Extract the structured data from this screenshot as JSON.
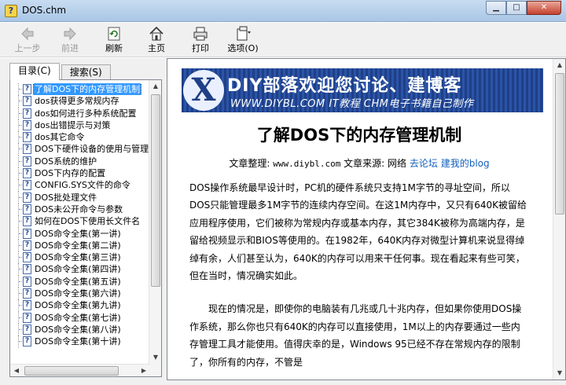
{
  "window": {
    "title": "DOS.chm"
  },
  "toolbar": {
    "buttons": [
      {
        "label": "上一步",
        "icon": "back-arrow-icon",
        "enabled": false
      },
      {
        "label": "前进",
        "icon": "forward-arrow-icon",
        "enabled": false
      },
      {
        "label": "刷新",
        "icon": "refresh-icon",
        "enabled": true
      },
      {
        "label": "主页",
        "icon": "home-icon",
        "enabled": true
      },
      {
        "label": "打印",
        "icon": "printer-icon",
        "enabled": true
      },
      {
        "label": "选项(O)",
        "icon": "options-icon",
        "enabled": true
      }
    ]
  },
  "nav": {
    "tabs": [
      {
        "label": "目录(C)",
        "active": true
      },
      {
        "label": "搜索(S)",
        "active": false
      }
    ],
    "items": [
      "了解DOS下的内存管理机制",
      "dos获得更多常规内存",
      "dos如何进行多种系统配置",
      "dos出错提示与对策",
      "dos其它命令",
      "DOS下硬件设备的使用与管理",
      "DOS系统的维护",
      "DOS下内存的配置",
      "CONFIG.SYS文件的命令",
      "DOS批处理文件",
      "DOS未公开命令与参数",
      "如何在DOS下使用长文件名",
      "DOS命令全集(第一讲)",
      "DOS命令全集(第二讲)",
      "DOS命令全集(第三讲)",
      "DOS命令全集(第四讲)",
      "DOS命令全集(第五讲)",
      "DOS命令全集(第六讲)",
      "DOS命令全集(第九讲)",
      "DOS命令全集(第七讲)",
      "DOS命令全集(第八讲)",
      "DOS命令全集(第十讲)"
    ],
    "selected_index": 0
  },
  "banner": {
    "logo": "X",
    "line1": "DIY部落欢迎您讨论、建博客",
    "line2": "WWW.DIYBL.COM IT教程 CHM电子书籍自己制作"
  },
  "article": {
    "title": "了解DOS下的内存管理机制",
    "meta_prefix": "文章整理:",
    "meta_site": "www.diybl.com",
    "meta_source_label": "文章来源: 网络",
    "meta_link1": "去论坛",
    "meta_link2": "建我的blog",
    "para1": "DOS操作系统最早设计时，PC机的硬件系统只支持1M字节的寻址空间，所以DOS只能管理最多1M字节的连续内存空间。在这1M内存中，又只有640K被留给应用程序使用，它们被称为常规内存或基本内存，其它384K被称为高端内存，是留给视频显示和BIOS等使用的。在1982年，640K内存对微型计算机来说显得绰绰有余，人们甚至认为，640K的内存可以用来干任何事。现在看起来有些可笑，但在当时，情况确实如此。",
    "para2": "现在的情况是，即使你的电脑装有几兆或几十兆内存，但如果你使用DOS操作系统，那么你也只有640K的内存可以直接使用，1M以上的内存要通过一些内存管理工具才能使用。值得庆幸的是，Windows 95已经不存在常规内存的限制了，你所有的内存，不管是"
  }
}
